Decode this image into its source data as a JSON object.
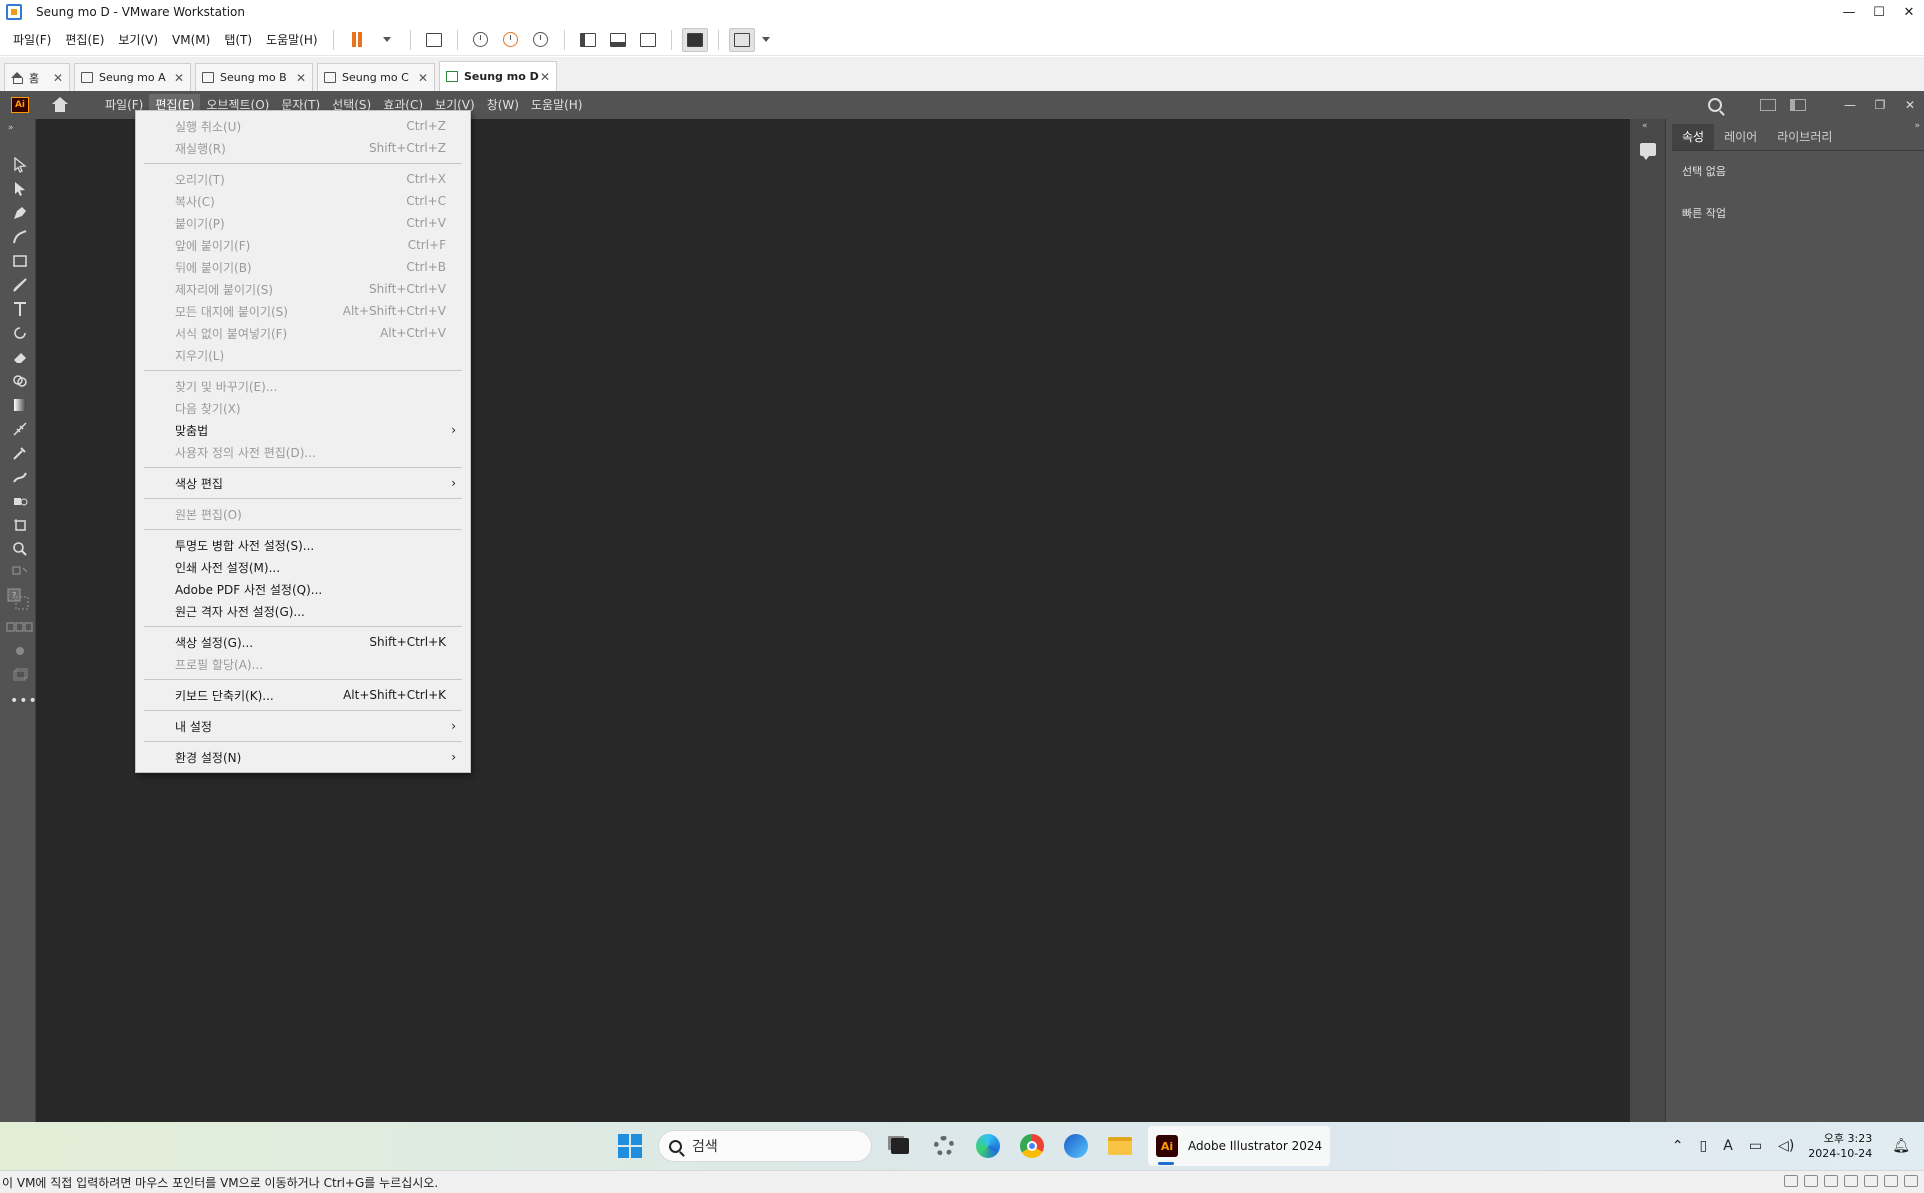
{
  "vmware": {
    "title": "Seung mo D - VMware Workstation",
    "menu": [
      "파일(F)",
      "편집(E)",
      "보기(V)",
      "VM(M)",
      "탭(T)",
      "도움말(H)"
    ],
    "tabs": [
      {
        "label": "홈",
        "type": "home"
      },
      {
        "label": "Seung mo A",
        "type": "vm"
      },
      {
        "label": "Seung mo B",
        "type": "vm"
      },
      {
        "label": "Seung mo C",
        "type": "vm"
      },
      {
        "label": "Seung mo D",
        "type": "vm-running",
        "active": true
      }
    ],
    "status_text": "이 VM에 직접 입력하려면 마우스 포인터를 VM으로 이동하거나 Ctrl+G를 누르십시오."
  },
  "illustrator": {
    "logo": "Ai",
    "menu": [
      "파일(F)",
      "편집(E)",
      "오브젝트(O)",
      "문자(T)",
      "선택(S)",
      "효과(C)",
      "보기(V)",
      "창(W)",
      "도움말(H)"
    ],
    "panel": {
      "tabs": [
        "속성",
        "레이어",
        "라이브러리"
      ],
      "no_selection": "선택 없음",
      "quick_actions": "빠른 작업"
    }
  },
  "edit_menu": {
    "items": [
      {
        "label": "실행 취소(U)",
        "shortcut": "Ctrl+Z",
        "disabled": true
      },
      {
        "label": "재실행(R)",
        "shortcut": "Shift+Ctrl+Z",
        "disabled": true
      },
      {
        "separator": true
      },
      {
        "label": "오리기(T)",
        "shortcut": "Ctrl+X",
        "disabled": true
      },
      {
        "label": "복사(C)",
        "shortcut": "Ctrl+C",
        "disabled": true
      },
      {
        "label": "붙이기(P)",
        "shortcut": "Ctrl+V",
        "disabled": true
      },
      {
        "label": "앞에 붙이기(F)",
        "shortcut": "Ctrl+F",
        "disabled": true
      },
      {
        "label": "뒤에 붙이기(B)",
        "shortcut": "Ctrl+B",
        "disabled": true
      },
      {
        "label": "제자리에 붙이기(S)",
        "shortcut": "Shift+Ctrl+V",
        "disabled": true
      },
      {
        "label": "모든 대지에 붙이기(S)",
        "shortcut": "Alt+Shift+Ctrl+V",
        "disabled": true
      },
      {
        "label": "서식 없이 붙여넣기(F)",
        "shortcut": "Alt+Ctrl+V",
        "disabled": true
      },
      {
        "label": "지우기(L)",
        "shortcut": "",
        "disabled": true
      },
      {
        "separator": true
      },
      {
        "label": "찾기 및 바꾸기(E)...",
        "shortcut": "",
        "disabled": true
      },
      {
        "label": "다음 찾기(X)",
        "shortcut": "",
        "disabled": true
      },
      {
        "label": "맞춤법",
        "shortcut": "",
        "disabled": false,
        "submenu": true
      },
      {
        "label": "사용자 정의 사전 편집(D)...",
        "shortcut": "",
        "disabled": true
      },
      {
        "separator": true
      },
      {
        "label": "색상 편집",
        "shortcut": "",
        "disabled": false,
        "submenu": true
      },
      {
        "separator": true
      },
      {
        "label": "원본 편집(O)",
        "shortcut": "",
        "disabled": true
      },
      {
        "separator": true
      },
      {
        "label": "투명도 병합 사전 설정(S)...",
        "shortcut": "",
        "disabled": false
      },
      {
        "label": "인쇄 사전 설정(M)...",
        "shortcut": "",
        "disabled": false
      },
      {
        "label": "Adobe PDF 사전 설정(Q)...",
        "shortcut": "",
        "disabled": false
      },
      {
        "label": "원근 격자 사전 설정(G)...",
        "shortcut": "",
        "disabled": false
      },
      {
        "separator": true
      },
      {
        "label": "색상 설정(G)...",
        "shortcut": "Shift+Ctrl+K",
        "disabled": false
      },
      {
        "label": "프로필 할당(A)...",
        "shortcut": "",
        "disabled": true
      },
      {
        "separator": true
      },
      {
        "label": "키보드 단축키(K)...",
        "shortcut": "Alt+Shift+Ctrl+K",
        "disabled": false
      },
      {
        "separator": true
      },
      {
        "label": "내 설정",
        "shortcut": "",
        "disabled": false,
        "submenu": true
      },
      {
        "separator": true
      },
      {
        "label": "환경 설정(N)",
        "shortcut": "",
        "disabled": false,
        "submenu": true
      }
    ]
  },
  "taskbar": {
    "search_placeholder": "검색",
    "active_app": "Adobe Illustrator 2024",
    "time": "오후 3:23",
    "date": "2024-10-24"
  }
}
